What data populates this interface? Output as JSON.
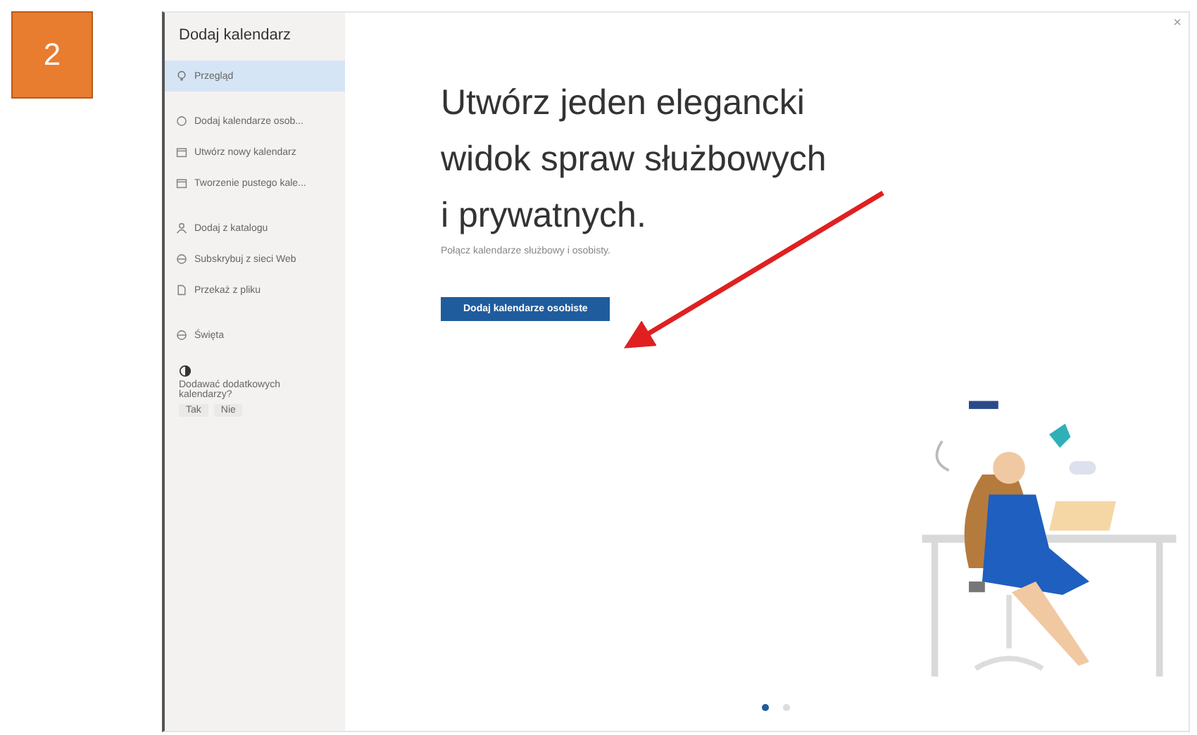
{
  "step_badge": "2",
  "sidebar": {
    "title": "Dodaj kalendarz",
    "groups": [
      [
        {
          "label": "Przegląd",
          "kind": "bulb",
          "selected": true
        }
      ],
      [
        {
          "label": "Dodaj kalendarze osob...",
          "kind": "circle",
          "selected": false
        },
        {
          "label": "Utwórz nowy kalendarz",
          "kind": "calendar",
          "selected": false
        },
        {
          "label": "Tworzenie pustego kale...",
          "kind": "calendar",
          "selected": false
        }
      ],
      [
        {
          "label": "Dodaj z katalogu",
          "kind": "person",
          "selected": false
        },
        {
          "label": "Subskrybuj z sieci Web",
          "kind": "globe",
          "selected": false
        },
        {
          "label": "Przekaż z pliku",
          "kind": "file",
          "selected": false
        }
      ],
      [
        {
          "label": "Święta",
          "kind": "globe",
          "selected": false
        }
      ]
    ],
    "feedback": {
      "question": "Dodawać dodatkowych kalendarzy?",
      "answers": [
        "Tak",
        "Nie"
      ]
    }
  },
  "main": {
    "close": "×",
    "heading": "Utwórz jeden elegancki widok spraw służbowych i prywatnych.",
    "subtitle": "Połącz kalendarze służbowy i osobisty.",
    "button": "Dodaj kalendarze osobiste",
    "dots": [
      {
        "selected": true
      },
      {
        "selected": false
      }
    ]
  }
}
